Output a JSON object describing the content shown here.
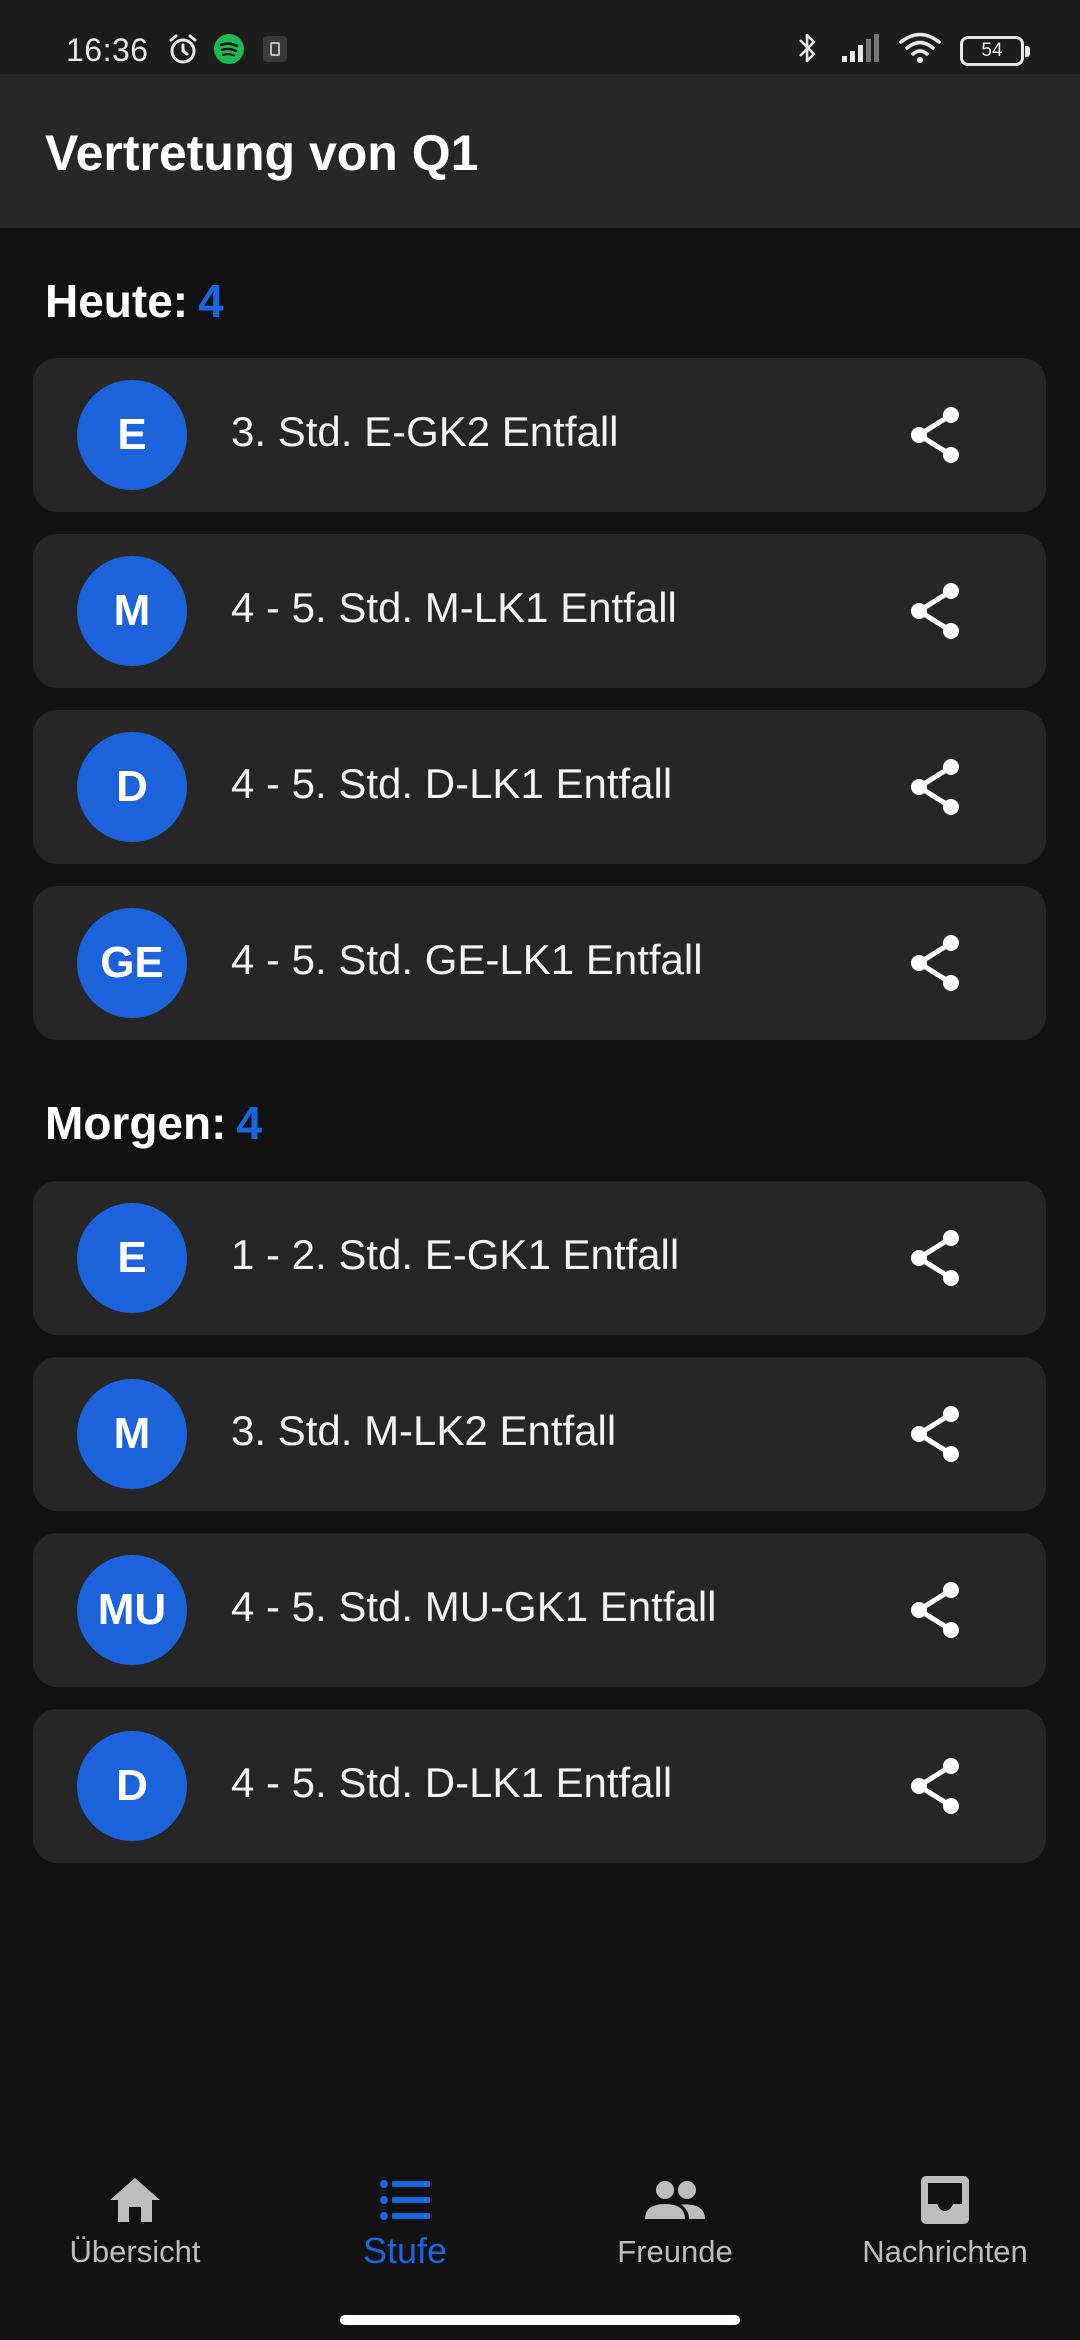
{
  "status_bar": {
    "time": "16:36",
    "battery": "54",
    "icons_left": [
      "alarm-icon",
      "spotify-icon",
      "app-notification-icon"
    ],
    "icons_right": [
      "bluetooth-icon",
      "signal-icon",
      "wifi-icon",
      "battery-icon"
    ]
  },
  "app_bar": {
    "title": "Vertretung von Q1"
  },
  "sections": [
    {
      "label": "Heute:",
      "count": "4",
      "items": [
        {
          "avatar": "E",
          "text": "3. Std. E-GK2 Entfall"
        },
        {
          "avatar": "M",
          "text": "4 - 5. Std. M-LK1 Entfall"
        },
        {
          "avatar": "D",
          "text": "4 - 5. Std. D-LK1 Entfall"
        },
        {
          "avatar": "GE",
          "text": "4 - 5. Std. GE-LK1 Entfall"
        }
      ]
    },
    {
      "label": "Morgen:",
      "count": "4",
      "items": [
        {
          "avatar": "E",
          "text": "1 - 2. Std. E-GK1 Entfall"
        },
        {
          "avatar": "M",
          "text": "3. Std. M-LK2 Entfall"
        },
        {
          "avatar": "MU",
          "text": "4 - 5. Std. MU-GK1 Entfall"
        },
        {
          "avatar": "D",
          "text": "4 - 5. Std. D-LK1 Entfall"
        }
      ]
    }
  ],
  "bottom_nav": {
    "items": [
      {
        "label": "Übersicht",
        "icon": "home-icon",
        "active": false
      },
      {
        "label": "Stufe",
        "icon": "list-icon",
        "active": true
      },
      {
        "label": "Freunde",
        "icon": "people-icon",
        "active": false
      },
      {
        "label": "Nachrichten",
        "icon": "inbox-icon",
        "active": false
      }
    ]
  },
  "colors": {
    "accent": "#1a66e0",
    "avatar_bg": "#1c63db",
    "card_bg": "#262626",
    "app_bar_bg": "#272727",
    "background": "#121212"
  }
}
